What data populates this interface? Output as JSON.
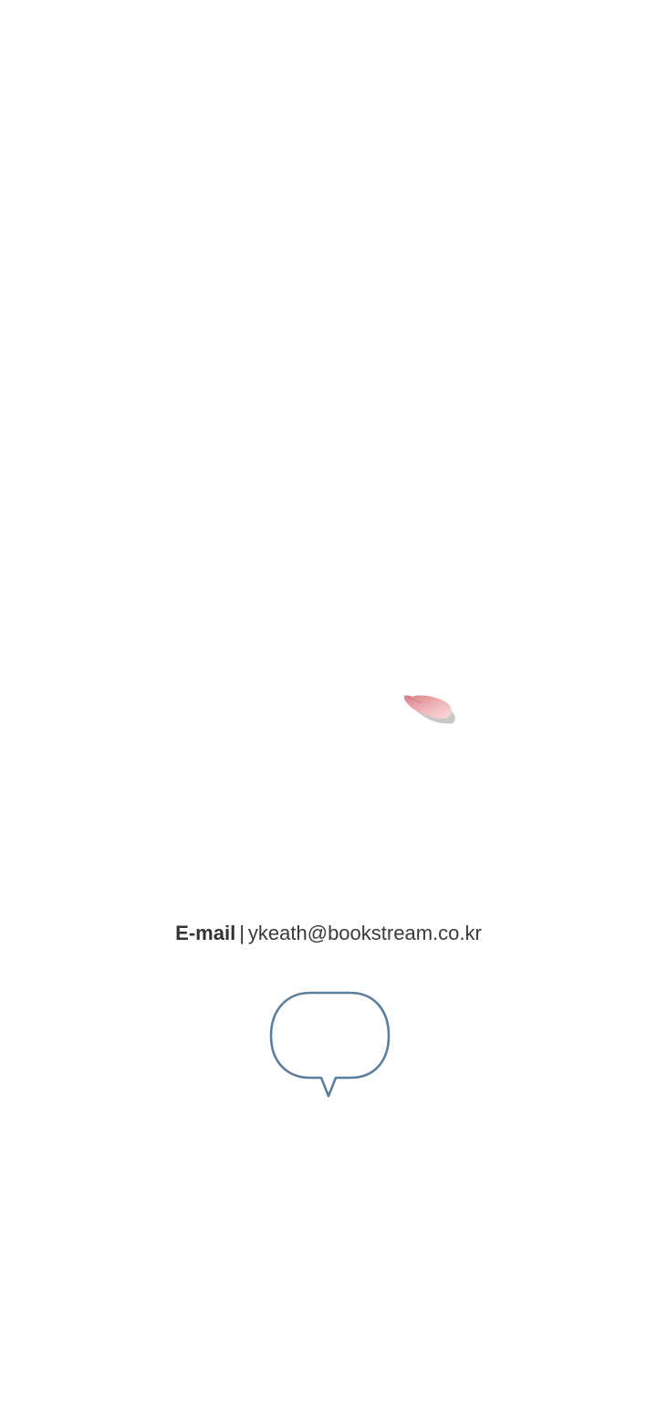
{
  "email": {
    "label": "E-mail",
    "separator": "|",
    "address": "ykeath@bookstream.co.kr"
  },
  "icons": {
    "petal": "cherry-blossom-petal-icon",
    "bubble": "speech-bubble-icon"
  },
  "colors": {
    "background": "#ffffff",
    "text": "#333333",
    "bubble_stroke": "#5b7f9e",
    "petal": "#e9a9ab"
  }
}
